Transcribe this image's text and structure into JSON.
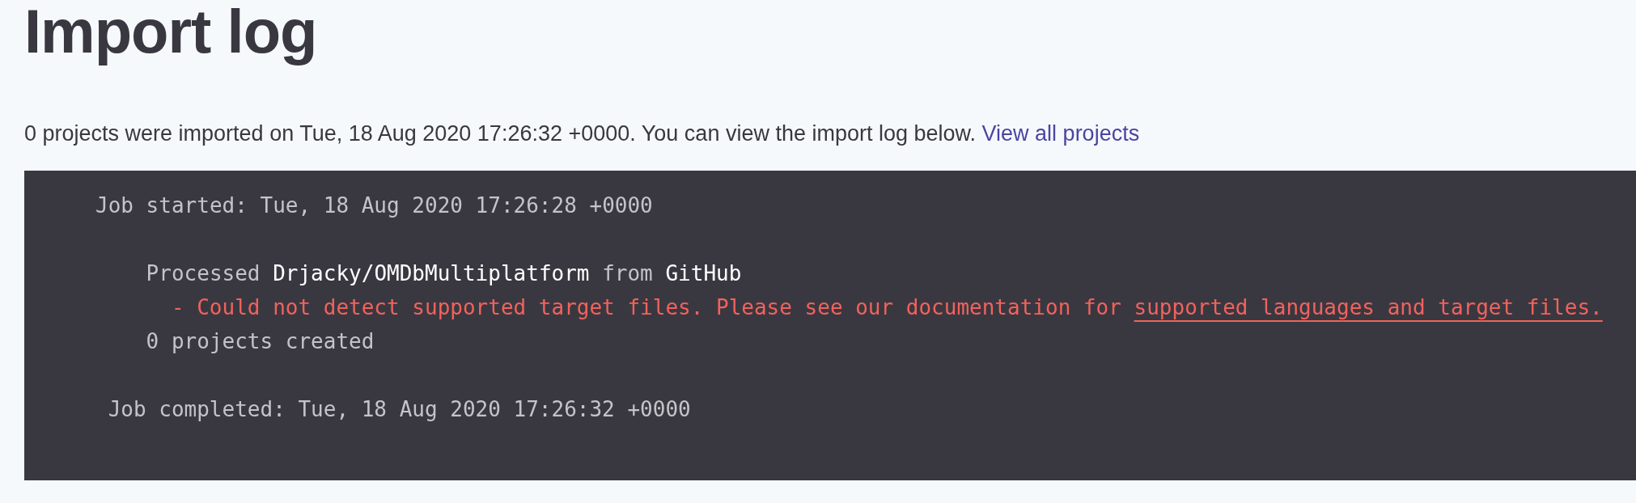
{
  "page": {
    "title": "Import log"
  },
  "summary": {
    "text": "0 projects were imported on Tue, 18 Aug 2020 17:26:32 +0000. You can view the import log below.",
    "link": "View all projects"
  },
  "log": {
    "started": "Job started: Tue, 18 Aug 2020 17:26:28 +0000",
    "imports": [
      {
        "prefix": "Processed",
        "repository": "Drjacky/OMDbMultiplatform",
        "connector": "from",
        "source": "GitHub",
        "errors": [
          {
            "text": "- Could not detect supported target files. Please see our documentation for",
            "link": "supported languages and target files."
          }
        ]
      }
    ],
    "result": "0 projects created",
    "completed": "Job completed: Tue, 18 Aug 2020 17:26:32 +0000"
  }
}
